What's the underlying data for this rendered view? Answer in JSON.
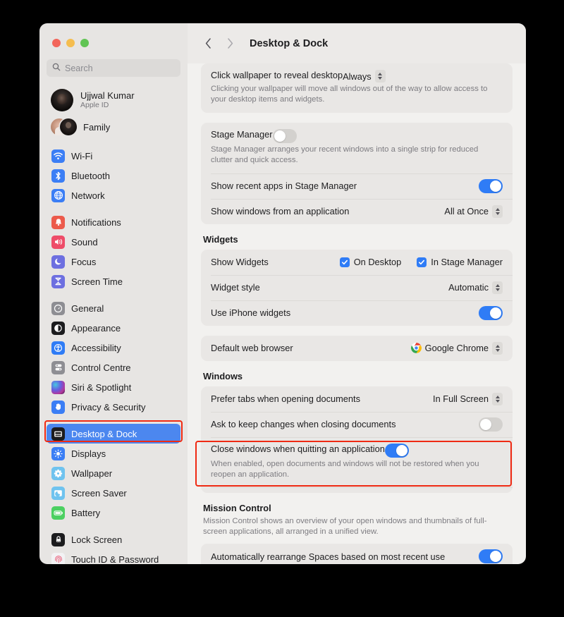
{
  "window": {
    "traffic_lights": [
      "close",
      "minimize",
      "zoom"
    ],
    "title": "Desktop & Dock"
  },
  "sidebar": {
    "search": {
      "placeholder": "Search",
      "value": "",
      "icon": "search-icon"
    },
    "account": {
      "name": "Ujjwal Kumar",
      "subtitle": "Apple ID",
      "avatar": "user-avatar"
    },
    "family": {
      "label": "Family",
      "avatar": "family-avatar"
    },
    "groups": [
      {
        "items": [
          {
            "label": "Wi-Fi",
            "icon": "wifi-icon",
            "color": "#3b7ef5",
            "selected": false
          },
          {
            "label": "Bluetooth",
            "icon": "bluetooth-icon",
            "color": "#3b7ef5",
            "selected": false
          },
          {
            "label": "Network",
            "icon": "network-icon",
            "color": "#3b7ef5",
            "selected": false
          }
        ]
      },
      {
        "items": [
          {
            "label": "Notifications",
            "icon": "notifications-icon",
            "color": "#ec5a4b",
            "selected": false
          },
          {
            "label": "Sound",
            "icon": "sound-icon",
            "color": "#ee4c68",
            "selected": false
          },
          {
            "label": "Focus",
            "icon": "focus-icon",
            "color": "#6d6fe0",
            "selected": false
          },
          {
            "label": "Screen Time",
            "icon": "screen-time-icon",
            "color": "#6d6fe0",
            "selected": false
          }
        ]
      },
      {
        "items": [
          {
            "label": "General",
            "icon": "general-icon",
            "color": "#8e8e93",
            "selected": false
          },
          {
            "label": "Appearance",
            "icon": "appearance-icon",
            "color": "#1c1c1e",
            "selected": false
          },
          {
            "label": "Accessibility",
            "icon": "accessibility-icon",
            "color": "#2f7cf6",
            "selected": false
          },
          {
            "label": "Control Centre",
            "icon": "control-centre-icon",
            "color": "#8e8e93",
            "selected": false
          },
          {
            "label": "Siri & Spotlight",
            "icon": "siri-icon",
            "color": "#3a2d4d",
            "selected": false
          },
          {
            "label": "Privacy & Security",
            "icon": "privacy-icon",
            "color": "#3b7ef5",
            "selected": false
          }
        ]
      },
      {
        "items": [
          {
            "label": "Desktop & Dock",
            "icon": "desktop-dock-icon",
            "color": "#1c1c1e",
            "selected": true
          },
          {
            "label": "Displays",
            "icon": "displays-icon",
            "color": "#3b7ef5",
            "selected": false
          },
          {
            "label": "Wallpaper",
            "icon": "wallpaper-icon",
            "color": "#6fc3ef",
            "selected": false
          },
          {
            "label": "Screen Saver",
            "icon": "screen-saver-icon",
            "color": "#6fc3ef",
            "selected": false
          },
          {
            "label": "Battery",
            "icon": "battery-icon",
            "color": "#4cd061",
            "selected": false
          }
        ]
      },
      {
        "items": [
          {
            "label": "Lock Screen",
            "icon": "lock-screen-icon",
            "color": "#1c1c1e",
            "selected": false
          },
          {
            "label": "Touch ID & Password",
            "icon": "touch-id-icon",
            "color": "#f2f2f4",
            "selected": false
          }
        ]
      }
    ]
  },
  "main": {
    "back_icon": "chevron-left-icon",
    "forward_icon": "chevron-right-icon",
    "click_wallpaper": {
      "title": "Click wallpaper to reveal desktop",
      "value": "Always",
      "description": "Clicking your wallpaper will move all windows out of the way to allow access to your desktop items and widgets."
    },
    "stage_manager": {
      "title": "Stage Manager",
      "description": "Stage Manager arranges your recent windows into a single strip for reduced clutter and quick access.",
      "enabled": false,
      "recent_apps_label": "Show recent apps in Stage Manager",
      "recent_apps_enabled": true,
      "show_windows_label": "Show windows from an application",
      "show_windows_value": "All at Once"
    },
    "widgets": {
      "heading": "Widgets",
      "show_widgets_label": "Show Widgets",
      "on_desktop_label": "On Desktop",
      "on_desktop_checked": true,
      "in_stage_manager_label": "In Stage Manager",
      "in_stage_manager_checked": true,
      "widget_style_label": "Widget style",
      "widget_style_value": "Automatic",
      "iphone_widgets_label": "Use iPhone widgets",
      "iphone_widgets_enabled": true
    },
    "default_browser": {
      "label": "Default web browser",
      "value": "Google Chrome",
      "icon": "chrome-icon"
    },
    "windows": {
      "heading": "Windows",
      "prefer_tabs_label": "Prefer tabs when opening documents",
      "prefer_tabs_value": "In Full Screen",
      "ask_keep_changes_label": "Ask to keep changes when closing documents",
      "ask_keep_changes_enabled": false,
      "close_windows_title": "Close windows when quitting an application",
      "close_windows_description": "When enabled, open documents and windows will not be restored when you reopen an application.",
      "close_windows_enabled": true
    },
    "mission_control": {
      "heading": "Mission Control",
      "description": "Mission Control shows an overview of your open windows and thumbnails of full-screen applications, all arranged in a unified view.",
      "rearrange_label": "Automatically rearrange Spaces based on most recent use",
      "rearrange_enabled": true
    }
  },
  "highlights": {
    "accent": "#ef2a13",
    "sidebar_item": "Desktop & Dock",
    "main_row": "Close windows when quitting an application"
  }
}
